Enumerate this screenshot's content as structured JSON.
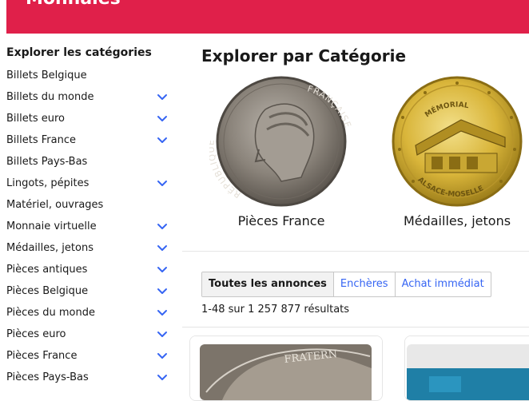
{
  "banner": {
    "title": "Monnaies",
    "color": "#e0204a"
  },
  "sidebar": {
    "heading": "Explorer les catégories",
    "items": [
      {
        "label": "Billets Belgique",
        "expandable": false
      },
      {
        "label": "Billets du monde",
        "expandable": true
      },
      {
        "label": "Billets euro",
        "expandable": true
      },
      {
        "label": "Billets France",
        "expandable": true
      },
      {
        "label": "Billets Pays-Bas",
        "expandable": false
      },
      {
        "label": "Lingots, pépites",
        "expandable": true
      },
      {
        "label": "Matériel, ouvrages",
        "expandable": false
      },
      {
        "label": "Monnaie virtuelle",
        "expandable": true
      },
      {
        "label": "Médailles, jetons",
        "expandable": true
      },
      {
        "label": "Pièces antiques",
        "expandable": true
      },
      {
        "label": "Pièces Belgique",
        "expandable": true
      },
      {
        "label": "Pièces du monde",
        "expandable": true
      },
      {
        "label": "Pièces euro",
        "expandable": true
      },
      {
        "label": "Pièces France",
        "expandable": true
      },
      {
        "label": "Pièces Pays-Bas",
        "expandable": true
      }
    ],
    "chevron_color": "#3665f3",
    "chevron_icon": "chevron-down-icon"
  },
  "main": {
    "title": "Explorer par Catégorie",
    "categories": [
      {
        "label": "Pièces France",
        "image_icon": "silver-coin-image",
        "coin_lettering_left": "RÉPUBLIQUE",
        "coin_lettering_right": "FRANÇAISE"
      },
      {
        "label": "Médailles, jetons",
        "image_icon": "gold-medal-image",
        "coin_lettering_top": "MÉMORIAL",
        "coin_lettering_bottom": "ALSACE-MOSELLE"
      }
    ],
    "tabs": [
      {
        "label": "Toutes les annonces",
        "active": true
      },
      {
        "label": "Enchères",
        "active": false
      },
      {
        "label": "Achat immédiat",
        "active": false
      }
    ],
    "results_text": "1-48 sur 1 257 877 résultats",
    "listing_1_lettering": "FRATERN"
  }
}
